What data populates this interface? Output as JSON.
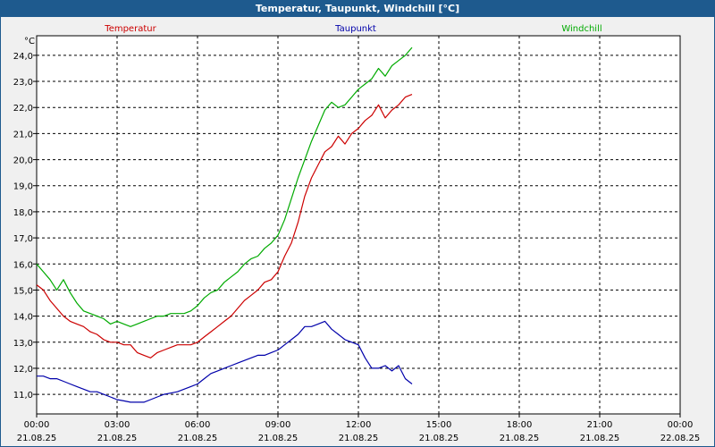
{
  "window": {
    "title": "Temperatur, Taupunkt, Windchill [°C]"
  },
  "colors": {
    "titlebar": "#1e5a8e",
    "temperature": "#cc0000",
    "dewpoint": "#0000aa",
    "windchill": "#00aa00",
    "grid": "#000000"
  },
  "chart_data": {
    "type": "line",
    "title": "Temperatur, Taupunkt, Windchill [°C]",
    "ylabel": "°C",
    "ylim": [
      10.25,
      24.75
    ],
    "yticks": [
      11.0,
      12.0,
      13.0,
      14.0,
      15.0,
      16.0,
      17.0,
      18.0,
      19.0,
      20.0,
      21.0,
      22.0,
      23.0,
      24.0
    ],
    "ytick_labels": [
      "11,0",
      "12,0",
      "13,0",
      "14,0",
      "15,0",
      "16,0",
      "17,0",
      "18,0",
      "19,0",
      "20,0",
      "21,0",
      "22,0",
      "23,0",
      "24,0"
    ],
    "xlim_hours": [
      0,
      24
    ],
    "xticks_hours": [
      0,
      3,
      6,
      9,
      12,
      15,
      18,
      21,
      24
    ],
    "xtick_time_labels": [
      "00:00",
      "03:00",
      "06:00",
      "09:00",
      "12:00",
      "15:00",
      "18:00",
      "21:00",
      "00:00"
    ],
    "xtick_date_labels": [
      "21.08.25",
      "21.08.25",
      "21.08.25",
      "21.08.25",
      "21.08.25",
      "21.08.25",
      "21.08.25",
      "21.08.25",
      "22.08.25"
    ],
    "grid": true,
    "legend_placement": "top",
    "series": [
      {
        "name": "Temperatur",
        "color": "#cc0000",
        "x": [
          0,
          0.25,
          0.5,
          0.75,
          1,
          1.25,
          1.5,
          1.75,
          2,
          2.25,
          2.5,
          2.75,
          3,
          3.25,
          3.5,
          3.75,
          4,
          4.25,
          4.5,
          4.75,
          5,
          5.25,
          5.5,
          5.75,
          6,
          6.25,
          6.5,
          6.75,
          7,
          7.25,
          7.5,
          7.75,
          8,
          8.25,
          8.5,
          8.75,
          9,
          9.25,
          9.5,
          9.75,
          10,
          10.25,
          10.5,
          10.75,
          11,
          11.25,
          11.5,
          11.75,
          12,
          12.25,
          12.5,
          12.75,
          13,
          13.25,
          13.5,
          13.75,
          14
        ],
        "y": [
          15.2,
          15.0,
          14.6,
          14.3,
          14.0,
          13.8,
          13.7,
          13.6,
          13.4,
          13.3,
          13.1,
          13.0,
          13.0,
          12.9,
          12.9,
          12.6,
          12.5,
          12.4,
          12.6,
          12.7,
          12.8,
          12.9,
          12.9,
          12.9,
          13.0,
          13.2,
          13.4,
          13.6,
          13.8,
          14.0,
          14.3,
          14.6,
          14.8,
          15.0,
          15.3,
          15.4,
          15.7,
          16.3,
          16.8,
          17.6,
          18.6,
          19.3,
          19.8,
          20.3,
          20.5,
          20.9,
          20.6,
          21.0,
          21.2,
          21.5,
          21.7,
          22.1,
          21.6,
          21.9,
          22.1,
          22.4,
          22.5
        ]
      },
      {
        "name": "Taupunkt",
        "color": "#0000aa",
        "x": [
          0,
          0.25,
          0.5,
          0.75,
          1,
          1.25,
          1.5,
          1.75,
          2,
          2.25,
          2.5,
          2.75,
          3,
          3.25,
          3.5,
          3.75,
          4,
          4.25,
          4.5,
          4.75,
          5,
          5.25,
          5.5,
          5.75,
          6,
          6.25,
          6.5,
          6.75,
          7,
          7.25,
          7.5,
          7.75,
          8,
          8.25,
          8.5,
          8.75,
          9,
          9.25,
          9.5,
          9.75,
          10,
          10.25,
          10.5,
          10.75,
          11,
          11.25,
          11.5,
          11.75,
          12,
          12.25,
          12.5,
          12.75,
          13,
          13.25,
          13.5,
          13.75,
          14
        ],
        "y": [
          11.7,
          11.7,
          11.6,
          11.6,
          11.5,
          11.4,
          11.3,
          11.2,
          11.1,
          11.1,
          11.0,
          10.9,
          10.8,
          10.75,
          10.7,
          10.7,
          10.7,
          10.8,
          10.9,
          11.0,
          11.05,
          11.1,
          11.2,
          11.3,
          11.4,
          11.6,
          11.8,
          11.9,
          12.0,
          12.1,
          12.2,
          12.3,
          12.4,
          12.5,
          12.5,
          12.6,
          12.7,
          12.9,
          13.1,
          13.3,
          13.6,
          13.6,
          13.7,
          13.8,
          13.5,
          13.3,
          13.1,
          13.0,
          12.9,
          12.4,
          12.0,
          12.0,
          12.1,
          11.9,
          12.1,
          11.6,
          11.4
        ]
      },
      {
        "name": "Windchill",
        "color": "#00aa00",
        "x": [
          0,
          0.25,
          0.5,
          0.75,
          1,
          1.25,
          1.5,
          1.75,
          2,
          2.25,
          2.5,
          2.75,
          3,
          3.25,
          3.5,
          3.75,
          4,
          4.25,
          4.5,
          4.75,
          5,
          5.25,
          5.5,
          5.75,
          6,
          6.25,
          6.5,
          6.75,
          7,
          7.25,
          7.5,
          7.75,
          8,
          8.25,
          8.5,
          8.75,
          9,
          9.25,
          9.5,
          9.75,
          10,
          10.25,
          10.5,
          10.75,
          11,
          11.25,
          11.5,
          11.75,
          12,
          12.25,
          12.5,
          12.75,
          13,
          13.25,
          13.5,
          13.75,
          14
        ],
        "y": [
          16.0,
          15.7,
          15.4,
          15.0,
          15.4,
          14.9,
          14.5,
          14.2,
          14.1,
          14.0,
          13.9,
          13.7,
          13.8,
          13.7,
          13.6,
          13.7,
          13.8,
          13.9,
          14.0,
          14.0,
          14.1,
          14.1,
          14.1,
          14.2,
          14.4,
          14.7,
          14.9,
          15.0,
          15.3,
          15.5,
          15.7,
          16.0,
          16.2,
          16.3,
          16.6,
          16.8,
          17.1,
          17.7,
          18.5,
          19.3,
          20.0,
          20.7,
          21.3,
          21.9,
          22.2,
          22.0,
          22.1,
          22.4,
          22.7,
          22.9,
          23.1,
          23.5,
          23.2,
          23.6,
          23.8,
          24.0,
          24.3
        ]
      }
    ]
  }
}
